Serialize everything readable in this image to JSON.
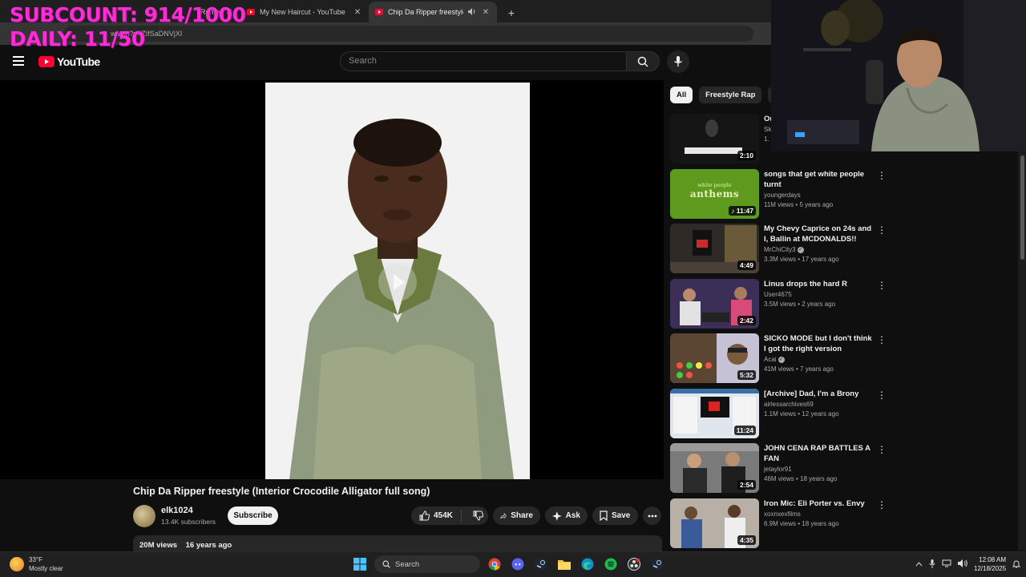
{
  "overlay": {
    "line1": "SUBCOUNT: 914/1000",
    "line2": "DAILY: 11/50"
  },
  "browser": {
    "tabs": [
      {
        "title": "Rome",
        "active": false
      },
      {
        "title": "My New Haircut - YouTube",
        "active": false
      },
      {
        "title": "Chip Da Ripper freestyle (In",
        "active": true
      }
    ],
    "close_glyph": "✕",
    "new_tab_glyph": "+",
    "address": "watch?v=ZIfSaDNVjXI"
  },
  "header": {
    "logo_text": "YouTube",
    "search_placeholder": "Search"
  },
  "video": {
    "title": "Chip Da Ripper freestyle (Interior Crocodile Alligator full song)",
    "channel": "elk1024",
    "subscribers": "13.4K subscribers",
    "subscribe_label": "Subscribe",
    "likes": "454K",
    "share_label": "Share",
    "ask_label": "Ask",
    "save_label": "Save",
    "views": "20M views",
    "age": "16 years ago"
  },
  "chips": [
    "All",
    "Freestyle Rap",
    "Po"
  ],
  "recommendations": [
    {
      "title": "",
      "channel": "",
      "meta": "",
      "duration": "2:10",
      "thumb_color": "#1a1a1a",
      "partial_title": "Ou",
      "partial_channel": "Sk",
      "partial_meta": "1."
    },
    {
      "title": "songs that get white people turnt",
      "channel": "youngerdays",
      "verified": false,
      "meta": "11M views • 5 years ago",
      "duration": "♪ 11:47",
      "thumb_color": "#5e9a1e",
      "thumb_text_small": "white people",
      "thumb_text_big": "anthems"
    },
    {
      "title": "My Chevy Caprice on 24s and I, Ballin at MCDONALDS!!",
      "channel": "MrChiCity3",
      "verified": true,
      "meta": "3.3M views • 17 years ago",
      "duration": "4:49",
      "thumb_color": "#3a3530"
    },
    {
      "title": "Linus drops the hard R",
      "channel": "User4675",
      "verified": false,
      "meta": "3.5M views • 2 years ago",
      "duration": "2:42",
      "thumb_color": "#3b2f58"
    },
    {
      "title": "SICKO MODE but I don't think I got the right version",
      "channel": "Acai",
      "verified": true,
      "meta": "41M views • 7 years ago",
      "duration": "5:32",
      "thumb_color": "#4a3a28"
    },
    {
      "title": "[Archive] Dad, I'm a Brony",
      "channel": "airlessarchives69",
      "verified": false,
      "meta": "1.1M views • 12 years ago",
      "duration": "11:24",
      "thumb_color": "#c9d4e2"
    },
    {
      "title": "JOHN CENA RAP BATTLES A FAN",
      "channel": "jetaylor91",
      "verified": false,
      "meta": "46M views • 18 years ago",
      "duration": "2:54",
      "thumb_color": "#5a5a5a"
    },
    {
      "title": "Iron Mic: Eli Porter vs. Envy",
      "channel": "xoxnxexfilms",
      "verified": false,
      "meta": "6.9M views • 18 years ago",
      "duration": "4:35",
      "thumb_color": "#a9a19a"
    }
  ],
  "taskbar": {
    "weather_temp": "33°F",
    "weather_desc": "Mostly clear",
    "search_label": "Search",
    "time": "12:08 AM",
    "date": "12/18/2025"
  },
  "colors": {
    "bg": "#0f0f0f",
    "brand": "#ff0033",
    "overlay": "#ff2bd6"
  }
}
